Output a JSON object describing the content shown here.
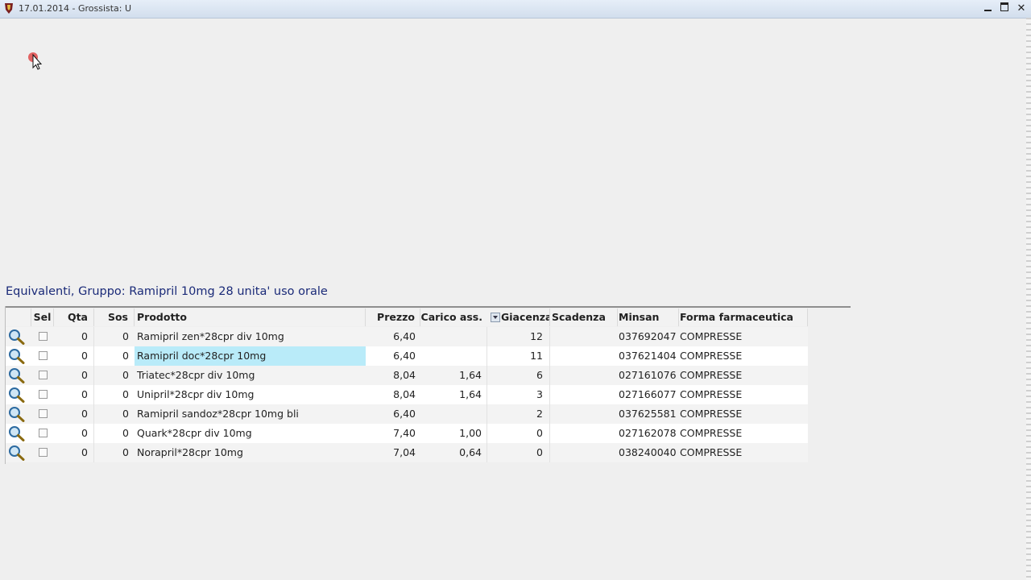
{
  "window": {
    "title": "17.01.2014 - Grossista: U",
    "buttons": {
      "minimize": "minimize",
      "restore": "restore",
      "close": "✕"
    }
  },
  "group": {
    "title": "Equivalenti, Gruppo: Ramipril 10mg 28 unita' uso orale"
  },
  "table": {
    "columns": {
      "sel": "Sel",
      "qta": "Qta",
      "sos": "Sos",
      "prodotto": "Prodotto",
      "prezzo": "Prezzo",
      "carico": "Carico ass.",
      "giacenza": "Giacenza",
      "scadenza": "Scadenza",
      "minsan": "Minsan",
      "forma": "Forma farmaceutica"
    },
    "rows": [
      {
        "qta": "0",
        "sos": "0",
        "prodotto": "Ramipril zen*28cpr div 10mg",
        "prezzo": "6,40",
        "carico": "",
        "giacenza": "12",
        "scadenza": "",
        "minsan": "037692047",
        "forma": "COMPRESSE"
      },
      {
        "qta": "0",
        "sos": "0",
        "prodotto": "Ramipril doc*28cpr 10mg",
        "prezzo": "6,40",
        "carico": "",
        "giacenza": "11",
        "scadenza": "",
        "minsan": "037621404",
        "forma": "COMPRESSE"
      },
      {
        "qta": "0",
        "sos": "0",
        "prodotto": "Triatec*28cpr div 10mg",
        "prezzo": "8,04",
        "carico": "1,64",
        "giacenza": "6",
        "scadenza": "",
        "minsan": "027161076",
        "forma": "COMPRESSE"
      },
      {
        "qta": "0",
        "sos": "0",
        "prodotto": "Unipril*28cpr div 10mg",
        "prezzo": "8,04",
        "carico": "1,64",
        "giacenza": "3",
        "scadenza": "",
        "minsan": "027166077",
        "forma": "COMPRESSE"
      },
      {
        "qta": "0",
        "sos": "0",
        "prodotto": "Ramipril sandoz*28cpr 10mg bli",
        "prezzo": "6,40",
        "carico": "",
        "giacenza": "2",
        "scadenza": "",
        "minsan": "037625581",
        "forma": "COMPRESSE"
      },
      {
        "qta": "0",
        "sos": "0",
        "prodotto": "Quark*28cpr div 10mg",
        "prezzo": "7,40",
        "carico": "1,00",
        "giacenza": "0",
        "scadenza": "",
        "minsan": "027162078",
        "forma": "COMPRESSE"
      },
      {
        "qta": "0",
        "sos": "0",
        "prodotto": "Norapril*28cpr 10mg",
        "prezzo": "7,04",
        "carico": "0,64",
        "giacenza": "0",
        "scadenza": "",
        "minsan": "038240040",
        "forma": "COMPRESSE"
      }
    ]
  },
  "icons": {
    "app": "app-icon",
    "row_detail": "magnifier-icon",
    "filter": "filter-dropdown-icon",
    "cursor": "mouse-cursor-icon"
  },
  "colors": {
    "selected_cell": "#b9ebf9",
    "group_title": "#1a2a78"
  }
}
